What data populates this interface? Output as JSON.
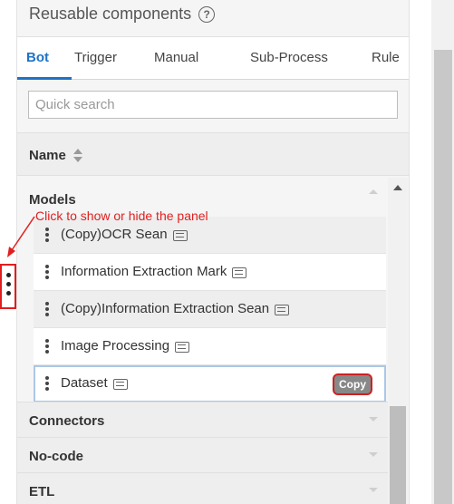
{
  "header": {
    "title": "Reusable components",
    "help_icon": "help-circle-icon"
  },
  "tabs": [
    {
      "label": "Bot",
      "active": true
    },
    {
      "label": "Trigger"
    },
    {
      "label": "Manual"
    },
    {
      "label": "Sub-Process"
    },
    {
      "label": "Rule"
    }
  ],
  "search": {
    "placeholder": "Quick search",
    "value": ""
  },
  "table": {
    "column_header": "Name",
    "sort_icon": "sort-icon"
  },
  "groups": {
    "models": {
      "label": "Models",
      "items": [
        {
          "label": "(Copy)OCR Sean",
          "icon": "bot-icon"
        },
        {
          "label": "Information Extraction Mark",
          "icon": "bot-icon"
        },
        {
          "label": "(Copy)Information Extraction Sean",
          "icon": "bot-icon"
        },
        {
          "label": "Image Processing",
          "icon": "bot-icon"
        },
        {
          "label": "Dataset",
          "icon": "bot-icon",
          "selected": true
        }
      ]
    },
    "connectors": {
      "label": "Connectors"
    },
    "nocode": {
      "label": "No-code"
    },
    "etl": {
      "label": "ETL"
    }
  },
  "copy_button": {
    "label": "Copy"
  },
  "annotation": {
    "text": "Click to show or hide the panel"
  },
  "colors": {
    "accent": "#1e73c8",
    "annotation": "#e02020",
    "copy_border": "#cc2222"
  }
}
